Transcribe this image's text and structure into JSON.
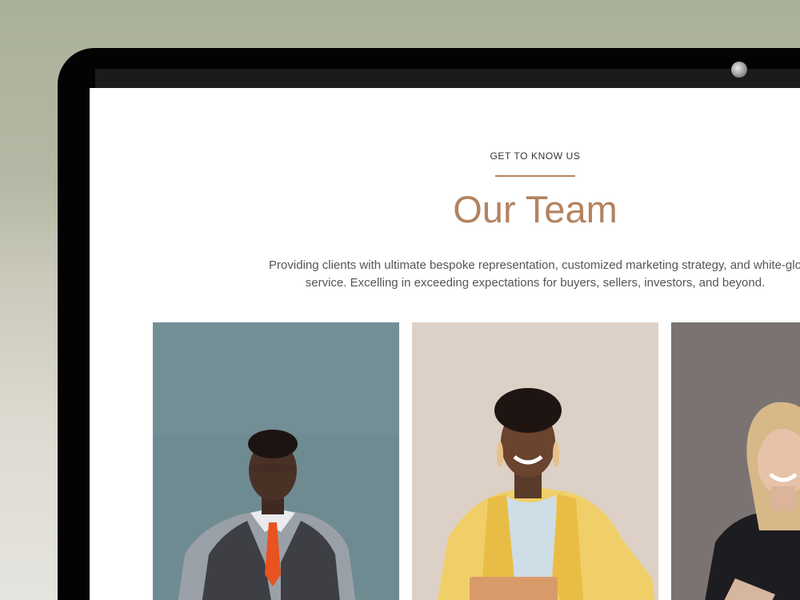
{
  "section": {
    "eyebrow": "GET TO KNOW US",
    "title": "Our Team",
    "intro_line1": "Providing clients with ultimate bespoke representation, customized marketing strategy, and white-glo",
    "intro_line2": "service. Excelling in exceeding expectations  for buyers, sellers, investors, and beyond."
  },
  "colors": {
    "accent": "#b3835f",
    "body_text": "#555555",
    "background": "#ffffff"
  },
  "team_photos": [
    {
      "subject": "man in grey vest and orange tie"
    },
    {
      "subject": "woman in yellow blazer holding tablet"
    },
    {
      "subject": "blonde woman in black top"
    }
  ]
}
